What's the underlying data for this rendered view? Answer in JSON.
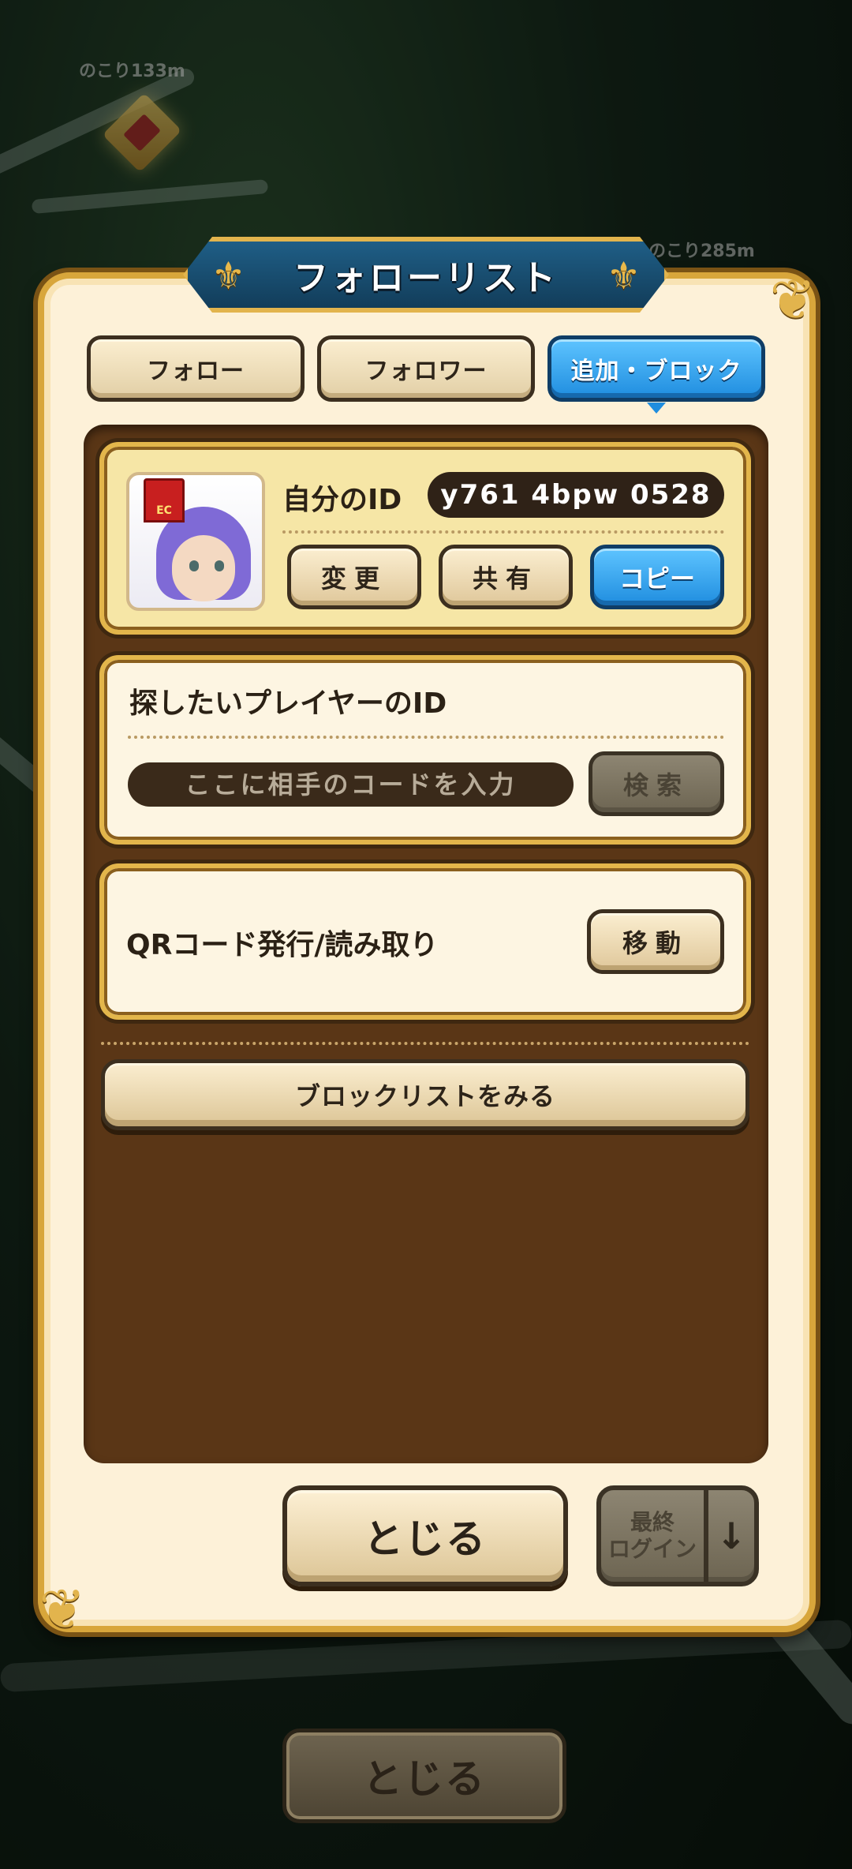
{
  "map": {
    "marker_labels": [
      "のこり133m",
      "のこり285m"
    ]
  },
  "dialog": {
    "title": "フォローリスト",
    "tabs": [
      {
        "label": "フォロー",
        "active": false
      },
      {
        "label": "フォロワー",
        "active": false
      },
      {
        "label": "追加・ブロック",
        "active": true
      }
    ]
  },
  "my_id": {
    "badge": "EC",
    "label": "自分のID",
    "value": "y761 4bpw 0528",
    "buttons": {
      "change": "変更",
      "share": "共有",
      "copy": "コピー"
    }
  },
  "search": {
    "title": "探したいプレイヤーのID",
    "placeholder": "ここに相手のコードを入力",
    "button": "検索"
  },
  "qr": {
    "label": "QRコード発行/読み取り",
    "button": "移動"
  },
  "block_list_button": "ブロックリストをみる",
  "footer": {
    "close_label": "とじる",
    "sort_label_line1": "最終",
    "sort_label_line2": "ログイン",
    "sort_arrow": "↓"
  },
  "background_close_label": "とじる",
  "colors": {
    "accent_blue": "#1f8ddf",
    "frame_gold": "#d8a63b",
    "content_brown": "#5a3616",
    "panel_cream": "#fdf1d8"
  }
}
